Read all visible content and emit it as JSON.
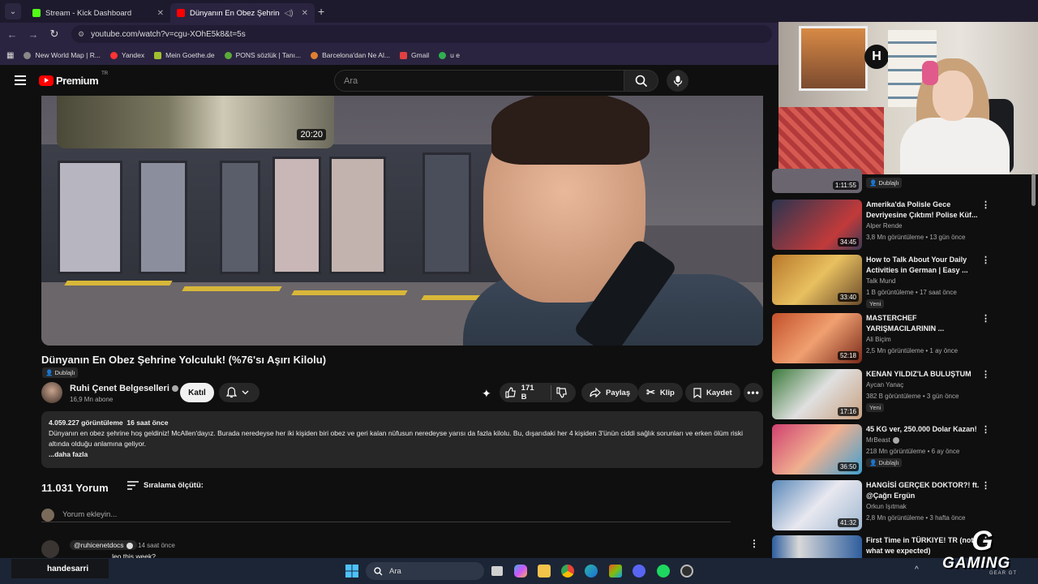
{
  "browser": {
    "tabs": [
      {
        "title": "Stream - Kick Dashboard",
        "favicon_color": "#53fc18"
      },
      {
        "title": "Dünyanın En Obez Şehrine",
        "favicon_color": "#ff0000"
      }
    ],
    "url": "youtube.com/watch?v=cgu-XOhE5k8&t=5s",
    "bookmarks": [
      {
        "label": "New World Map | R...",
        "color": "#888888"
      },
      {
        "label": "Yandex",
        "color": "#ff3333"
      },
      {
        "label": "Mein Goethe.de",
        "color": "#a0c030"
      },
      {
        "label": "PONS sözlük | Tanı...",
        "color": "#5aaa3a"
      },
      {
        "label": "Barcelona'dan Ne Al...",
        "color": "#e08030"
      },
      {
        "label": "Gmail",
        "color": "#e04040"
      },
      {
        "label": "u e",
        "color": "#30b050"
      }
    ]
  },
  "youtube": {
    "logo_text": "Premium",
    "logo_sup": "TR",
    "search_placeholder": "Ara"
  },
  "player": {
    "mini_duration": "20:20"
  },
  "video": {
    "title": "Dünyanın En Obez Şehrine Yolculuk! (%76'sı Aşırı Kilolu)",
    "dubbed": "Dublajlı",
    "channel": "Ruhi Çenet Belgeselleri",
    "subscribers": "16,9 Mn abone",
    "join_label": "Katıl",
    "likes": "171 B",
    "share_label": "Paylaş",
    "clip_label": "Klip",
    "save_label": "Kaydet"
  },
  "description": {
    "views": "4.059.227 görüntüleme",
    "age": "16 saat önce",
    "text": "Dünyanın en obez şehrine hoş geldiniz! McAllen'dayız. Burada neredeyse her iki kişiden biri obez ve geri kalan nüfusun neredeyse yarısı da fazla kilolu. Bu, dışarıdaki her 4 kişiden 3'ünün ciddi sağlık sorunları ve erken ölüm riski altında olduğu anlamına geliyor.",
    "more": "...daha fazla"
  },
  "comments": {
    "count": "11.031 Yorum",
    "sort_label": "Sıralama ölçütü:",
    "add_placeholder": "Yorum ekleyin...",
    "first": {
      "handle": "@ruhicenetdocs",
      "time": "14 saat önce",
      "text": "...leo this week?"
    }
  },
  "sidebar": {
    "first_dubbed": "Dublajlı",
    "first_duration": "1:11:55",
    "videos": [
      {
        "title": "Amerika'da Polisle Gece Devriyesine Çıktım! Polise Küf...",
        "channel": "Alper Rende",
        "meta": "3,8 Mn görüntüleme • 13 gün önce",
        "duration": "34:45",
        "badge": "",
        "thumb_color": "#2a3550"
      },
      {
        "title": "How to Talk About Your Daily Activities in German | Easy ...",
        "channel": "Talk Mund",
        "meta": "1 B görüntüleme • 17 saat önce",
        "duration": "33:40",
        "badge": "Yeni",
        "thumb_color": "#b8782a"
      },
      {
        "title": "MASTERCHEF YARIŞMACILARININ ...",
        "channel": "Ali Biçim",
        "meta": "2,5 Mn görüntüleme • 1 ay önce",
        "duration": "52:18",
        "badge": "",
        "thumb_color": "#c4502a"
      },
      {
        "title": "KENAN YILDIZ'LA BULUŞTUM",
        "channel": "Aycan Yanaç",
        "meta": "382 B görüntüleme • 3 gün önce",
        "duration": "17:16",
        "badge": "Yeni",
        "thumb_color": "#3a7a3a"
      },
      {
        "title": "45 KG ver, 250.000 Dolar Kazan!",
        "channel": "MrBeast",
        "meta": "218 Mn görüntüleme • 6 ay önce",
        "duration": "36:50",
        "badge": "Dublajlı",
        "thumb_color": "#d04070"
      },
      {
        "title": "HANGİSİ GERÇEK DOKTOR?! ft. @Çağrı Ergün",
        "channel": "Orkun Işıtmak",
        "meta": "2,8 Mn görüntüleme • 3 hafta önce",
        "duration": "41:32",
        "badge": "",
        "thumb_color": "#5a88b8"
      },
      {
        "title": "First Time in TÜRKIYE! TR (not what we expected)",
        "channel": "",
        "meta": "",
        "duration": "",
        "badge": "",
        "thumb_color": "#2e5e9e"
      }
    ]
  },
  "taskbar": {
    "search_label": "Ara"
  },
  "overlay": {
    "username": "handesarri",
    "brand": "GAMING",
    "brand_sub": "GEAR GT"
  }
}
